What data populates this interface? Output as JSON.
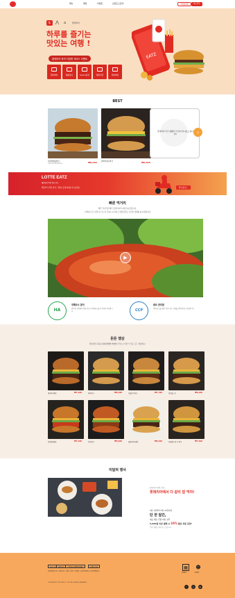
{
  "header": {
    "nav": [
      "메뉴",
      "매장",
      "이벤트",
      "브랜드스토리"
    ],
    "btn_login": "가맹점회원",
    "btn_order": "바로주문"
  },
  "hero": {
    "brand_tag": "롯데리아",
    "title_line1": "하루를 즐기는",
    "title_line2": "맛있는 여행 !",
    "pill": "롯데리아 와의 다양한 서비스 이벤트",
    "services": [
      "딜리버리",
      "매장찾기",
      "Green환경",
      "회원가입",
      "딜리버리"
    ],
    "app_label": "EATZ"
  },
  "best": {
    "title": "BEST",
    "items": [
      {
        "name": "더블바베큐버거",
        "desc": "두툼한 패티에 바베큐소스",
        "price": "₩8,000"
      },
      {
        "name": "클래식치즈버거",
        "desc": "치즈가 가득한 클래식",
        "price": "₩6,800"
      }
    ],
    "more_text": "롯데리아 인기 상품을 더 많이 만나보고 싶다면?"
  },
  "eatz_banner": {
    "title": "LOTTE EATZ",
    "subtitle": "배달에서 픽업 까지 모두",
    "desc": "배달부터 픽업 까지, 가까운 롯데리아를 만나보세요",
    "button": "앱 다운로드"
  },
  "fast_food": {
    "title": "빠른 먹거리",
    "desc1": "빠른 먹거리란 빠른 롯데리아의 서비스를 뜻합니다.",
    "desc2": "고객님이 요구 맛을 더 오도록 가치는 신선하고 맛있게 있는 신선한 맛제를 를 사용합니다."
  },
  "certs": [
    {
      "badge": "HA",
      "title": "위해요소 분석",
      "desc": "원료와 공정에서 발생 가능한 위해요소를 분석하여 관리합니다"
    },
    {
      "badge": "CCP",
      "title": "중요 관리점",
      "desc": "위해 요소를 예방, 제거 하는 단계를 중점적으로 관리합니다"
    }
  ],
  "new_menu": {
    "title": "든든 행상",
    "desc": "행상하진디자를 (쉐세)빵빵빵 빵빵빵 가격으로 만날 수 있는 든든 행상메뉴!",
    "items": [
      {
        "name": "데리버거세트",
        "price": "₩7,200"
      },
      {
        "name": "새우버거",
        "price": "₩6,500"
      },
      {
        "name": "더블치즈버거",
        "price": "₩7,700"
      },
      {
        "name": "한우불고기",
        "price": "₩9,200"
      },
      {
        "name": "치킨휠레세트",
        "price": "₩7,300"
      },
      {
        "name": "양념치킨",
        "price": "₩5,000"
      },
      {
        "name": "클래식버거세트",
        "price": "₩6,300"
      },
      {
        "name": "모짜렐라 인 더 버거",
        "price": "₩7,500"
      }
    ]
  },
  "event": {
    "title": "이달의 행사",
    "small": "롯데리아 이벤트 안내",
    "headline": "롯데리아에서 다 같이 밥 먹자!",
    "date_line": "5월 1일부터 5월 31일까지",
    "big": "단 한 달간,",
    "line3": "세트 메뉴 주문 하실 경우",
    "discount_prefix": "5,000원 이상 결제 시",
    "discount": "10%",
    "discount_suffix": "할인 쿠폰 증정!",
    "note": "*일부 매장은 제외 될 수 있습니다."
  },
  "footer": {
    "buttons": [
      "회사소개",
      "채용안내",
      "고객센터(1588-5000)",
      "가맹점 안내"
    ],
    "info1": "롯데지알에스(주) | 대표이사 | 서울시 금천구 디지털로 | 사업자등록번호 | 통신판매업신고",
    "info2": "COPYRIGHT LOTTE GRS CO.,LTD. ALL RIGHTS RESERVED",
    "icon_labels": [
      "매장찾기",
      "고객센터"
    ],
    "sns": [
      "f",
      "◎",
      "▶"
    ]
  },
  "colors": {
    "brand_red": "#e12b22",
    "hero_bg": "#f9dec2",
    "footer_bg": "#f8a85c",
    "section_bg": "#f7eee6"
  }
}
